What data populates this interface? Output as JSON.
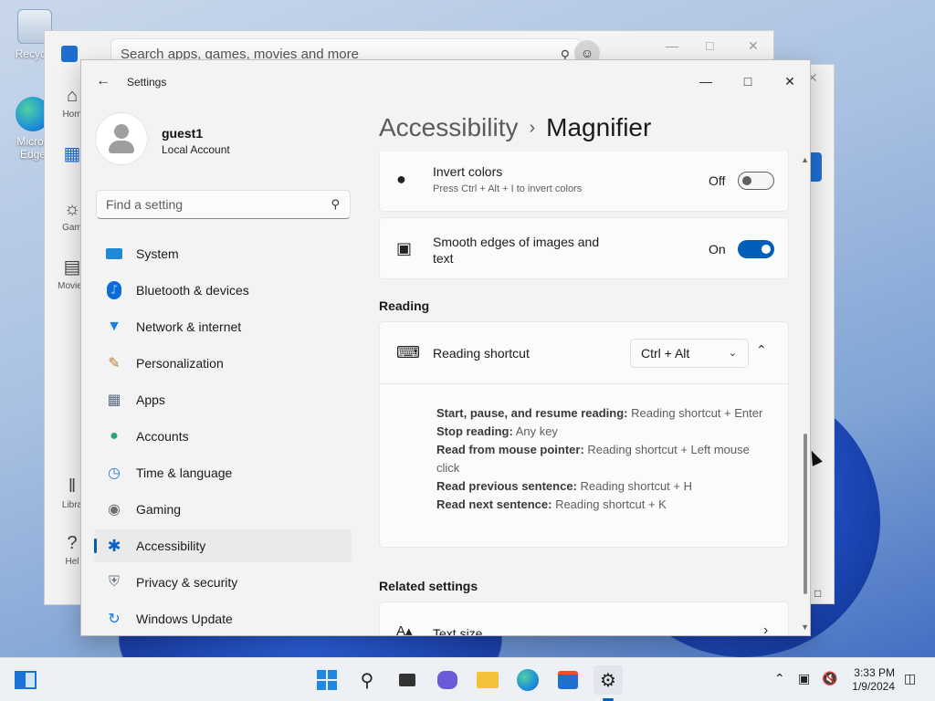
{
  "desktop": {
    "icons": [
      {
        "label": "Recycle"
      },
      {
        "label": "Micros Edge"
      }
    ]
  },
  "store": {
    "search_placeholder": "Search apps, games, movies and more",
    "side_items": [
      "Hom",
      "Gam",
      "Movies",
      "Libra",
      "Hel"
    ]
  },
  "settings": {
    "title": "Settings",
    "user": {
      "name": "guest1",
      "account_type": "Local Account"
    },
    "find_placeholder": "Find a setting",
    "nav": [
      {
        "label": "System",
        "icon": "monitor-icon",
        "color": "#1f8ad6"
      },
      {
        "label": "Bluetooth & devices",
        "icon": "bluetooth-icon",
        "color": "#0a6cd8"
      },
      {
        "label": "Network & internet",
        "icon": "wifi-icon",
        "color": "#1a7de0"
      },
      {
        "label": "Personalization",
        "icon": "brush-icon",
        "color": "#c27a33"
      },
      {
        "label": "Apps",
        "icon": "apps-icon",
        "color": "#5a6b82"
      },
      {
        "label": "Accounts",
        "icon": "person-icon",
        "color": "#2aa37a"
      },
      {
        "label": "Time & language",
        "icon": "globe-clock-icon",
        "color": "#2b7cd6"
      },
      {
        "label": "Gaming",
        "icon": "controller-icon",
        "color": "#6d6d6d"
      },
      {
        "label": "Accessibility",
        "icon": "accessibility-icon",
        "color": "#0a64c8"
      },
      {
        "label": "Privacy & security",
        "icon": "shield-icon",
        "color": "#6f7a86"
      },
      {
        "label": "Windows Update",
        "icon": "update-icon",
        "color": "#1a7de0"
      }
    ],
    "active_nav": "Accessibility",
    "breadcrumb": {
      "parent": "Accessibility",
      "current": "Magnifier"
    },
    "invert": {
      "title": "Invert colors",
      "subtitle": "Press Ctrl + Alt + I to invert colors",
      "state": "Off"
    },
    "smooth": {
      "title": "Smooth edges of images and text",
      "state": "On"
    },
    "reading_section": "Reading",
    "reading_shortcut": {
      "title": "Reading shortcut",
      "value": "Ctrl + Alt"
    },
    "shortcuts": [
      {
        "label": "Start, pause, and resume reading:",
        "value": "Reading shortcut + Enter"
      },
      {
        "label": "Stop reading:",
        "value": "Any key"
      },
      {
        "label": "Read from mouse pointer:",
        "value": "Reading shortcut + Left mouse click"
      },
      {
        "label": "Read previous sentence:",
        "value": "Reading shortcut + H"
      },
      {
        "label": "Read next sentence:",
        "value": "Reading shortcut + K"
      }
    ],
    "related_section": "Related settings",
    "text_size": "Text size"
  },
  "taskbar": {
    "time": "3:33 PM",
    "date": "1/9/2024"
  }
}
